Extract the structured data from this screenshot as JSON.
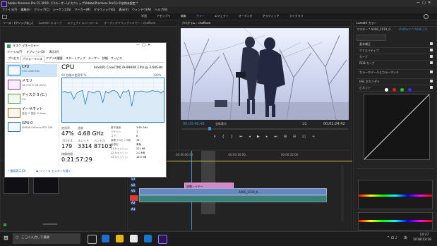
{
  "premiere": {
    "title": "Adobe Premiere Pro CC 2019 - C:\\ユーザー\\デスクトップ\\Adobe\\Premiere Pro\\13.0\\名称未設定 *",
    "menu": [
      "ファイル(F)",
      "編集(E)",
      "クリップ(C)",
      "シーケンス(S)",
      "マーカー(M)",
      "グラフィック(G)",
      "表示(V)",
      "ウィンドウ(W)",
      "ヘルプ(H)"
    ],
    "workspaces": [
      "学習",
      "アセンブリ",
      "編集",
      "カラー",
      "エフェクト",
      "オーディオ",
      "グラフィック",
      "ライブラリ"
    ],
    "active_workspace": "カラー",
    "source_tabs": [
      "ソース : (クリップなし)",
      "Lumetri スコープ",
      "エフェクトコントロール",
      "オーディオクリップミキサー : chaflorm"
    ],
    "program_tab": "プログラム : chaflorm",
    "lumetri_tab": "Lumetri カラー",
    "lumetri_sections": [
      "基本補正",
      "クリエイティブ",
      "カーブ",
      "RGB カーブ",
      "カラーホイールとカラーマッチ",
      "HSL セカンダリ",
      "ビネット"
    ],
    "lumetri_master": "マスター * A006_C019_0...",
    "lumetri_seq": "chaflorm * A006_C0...",
    "timecode_in": "00:00:48:48",
    "timecode_out": "00:01:24:42",
    "zoom": "全体表示",
    "quality": "1/2",
    "ruler": [
      "00:00:00:00",
      "00:00:16:00",
      "00:00:32:00"
    ],
    "tracks": [
      "V3",
      "V2",
      "V1",
      "A1",
      "A2",
      "A3"
    ],
    "clip_pink": "調整レイヤー",
    "clip_blue": "A006_C019_0..."
  },
  "taskmgr": {
    "title": "タスク マネージャー",
    "menu": [
      "ファイル(F)",
      "オプション(O)",
      "表示(V)"
    ],
    "tabs": [
      "プロセス",
      "パフォーマンス",
      "アプリの履歴",
      "スタートアップ",
      "ユーザー",
      "詳細",
      "サービス"
    ],
    "active_tab": "パフォーマンス",
    "side": [
      {
        "name": "CPU",
        "sub": "47% 4.68 GHz"
      },
      {
        "name": "メモリ",
        "sub": "16.7/31.9 GB (52%)"
      },
      {
        "name": "ディスク 0 (C:)",
        "sub": "2%"
      },
      {
        "name": "イーサネット",
        "sub": "送信: 0 受信: 0 Kbps"
      },
      {
        "name": "GPU 0",
        "sub": "NVIDIA GeForce RTX 208"
      }
    ],
    "cpu_title": "CPU",
    "cpu_model": "Intel(R) Core(TM) i9-9900K CPU @ 3.60GHz",
    "graph_label": "60 秒間の使用率 %",
    "graph_max": "100%",
    "usage_label": "使用率",
    "usage_value": "47%",
    "speed_label": "速度",
    "speed_value": "4.68 GHz",
    "proc_label": "プロセス",
    "proc_value": "179",
    "thread_label": "スレッド",
    "thread_value": "3314",
    "handle_label": "ハンドル",
    "handle_value": "87103",
    "uptime_label": "稼働時間",
    "uptime_value": "0:21:57:29",
    "specs": [
      {
        "k": "基本速度:",
        "v": "3.60 GHz"
      },
      {
        "k": "ソケット:",
        "v": "1"
      },
      {
        "k": "コア:",
        "v": "8"
      },
      {
        "k": "論理プロセッサ数:",
        "v": "16"
      },
      {
        "k": "仮想化:",
        "v": "有効"
      },
      {
        "k": "L1 キャッシュ:",
        "v": "512 KB"
      },
      {
        "k": "L2 キャッシュ:",
        "v": "2.0 MB"
      },
      {
        "k": "L3 キャッシュ:",
        "v": "16.0 MB"
      }
    ],
    "less": "簡易表示(D)",
    "open_monitor": "リソース モニターを開く",
    "cpu_series": [
      68,
      70,
      66,
      69,
      52,
      66,
      70,
      72,
      40,
      70,
      68,
      66,
      71,
      70,
      44,
      70,
      66,
      71,
      72,
      68,
      55,
      70,
      68,
      73,
      36,
      70,
      69,
      71,
      70,
      68,
      69,
      72,
      70,
      71,
      66,
      71
    ]
  },
  "taskbar": {
    "search": "ここに入力して検索",
    "time": "14:27",
    "date": "2018/12/28",
    "lang": "あ"
  }
}
